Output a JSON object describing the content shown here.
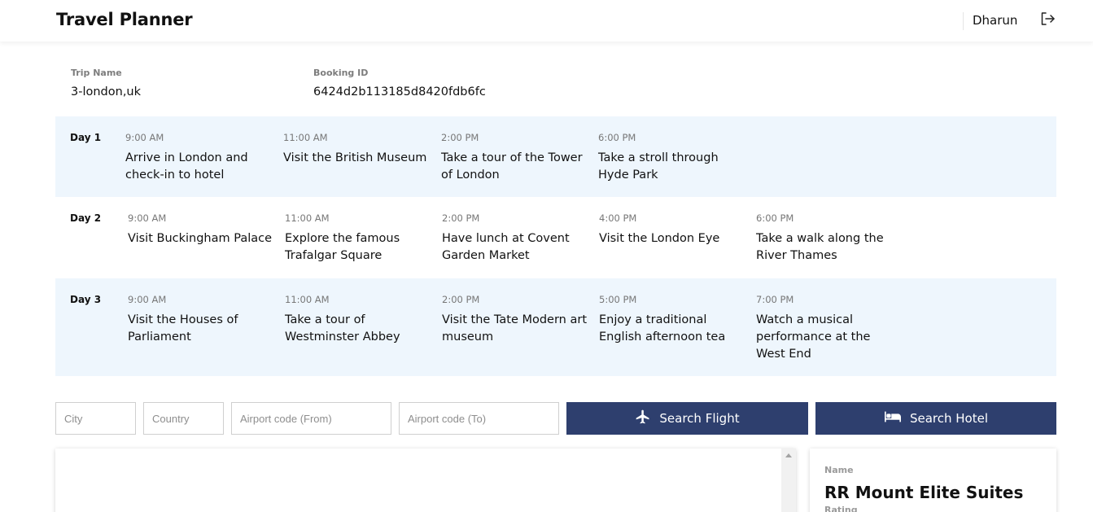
{
  "header": {
    "app_title": "Travel Planner",
    "user_name": "Dharun",
    "logout_icon": "logout-icon"
  },
  "trip": {
    "name_label": "Trip Name",
    "name_value": "3-london,uk",
    "booking_label": "Booking ID",
    "booking_value": "6424d2b113185d8420fdb6fc"
  },
  "itinerary": [
    {
      "day": "Day 1",
      "activities": [
        {
          "time": "9:00 AM",
          "desc": "Arrive in London and check-in to hotel"
        },
        {
          "time": "11:00 AM",
          "desc": "Visit the British Museum"
        },
        {
          "time": "2:00 PM",
          "desc": "Take a tour of the Tower of London"
        },
        {
          "time": "6:00 PM",
          "desc": "Take a stroll through Hyde Park"
        }
      ]
    },
    {
      "day": "Day 2",
      "activities": [
        {
          "time": "9:00 AM",
          "desc": "Visit Buckingham Palace"
        },
        {
          "time": "11:00 AM",
          "desc": "Explore the famous Trafalgar Square"
        },
        {
          "time": "2:00 PM",
          "desc": "Have lunch at Covent Garden Market"
        },
        {
          "time": "4:00 PM",
          "desc": "Visit the London Eye"
        },
        {
          "time": "6:00 PM",
          "desc": "Take a walk along the River Thames"
        }
      ]
    },
    {
      "day": "Day 3",
      "activities": [
        {
          "time": "9:00 AM",
          "desc": "Visit the Houses of Parliament"
        },
        {
          "time": "11:00 AM",
          "desc": "Take a tour of Westminster Abbey"
        },
        {
          "time": "2:00 PM",
          "desc": "Visit the Tate Modern art museum"
        },
        {
          "time": "5:00 PM",
          "desc": "Enjoy a traditional English afternoon tea"
        },
        {
          "time": "7:00 PM",
          "desc": "Watch a musical performance at the West End"
        }
      ]
    }
  ],
  "search": {
    "city_placeholder": "City",
    "country_placeholder": "Country",
    "airport_from_placeholder": "Airport code (From)",
    "airport_to_placeholder": "Airport code (To)",
    "flight_button": "Search Flight",
    "flight_icon": "airplane-icon",
    "hotel_button": "Search Hotel",
    "hotel_icon": "bed-icon"
  },
  "hotel": {
    "name_label": "Name",
    "name_value": "RR Mount Elite Suites",
    "rating_label": "Rating"
  },
  "colors": {
    "accent": "#2e3f6e",
    "row_shade": "#eef6fd"
  }
}
